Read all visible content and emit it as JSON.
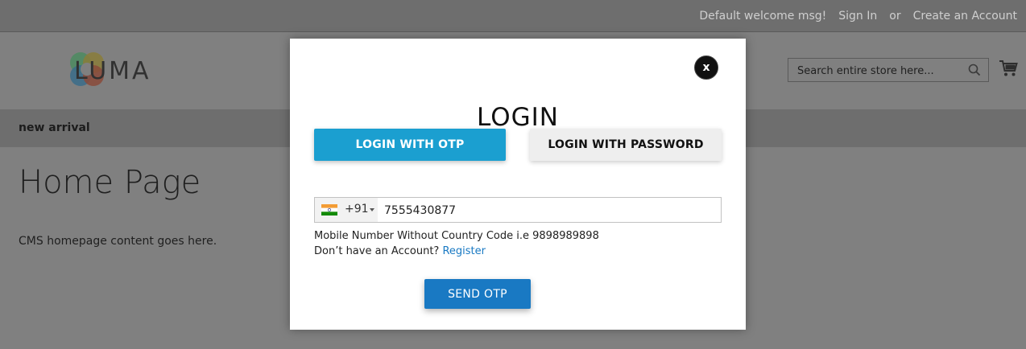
{
  "topbar": {
    "welcome": "Default welcome msg!",
    "sign_in": "Sign In",
    "or": "or",
    "create_account": "Create an Account"
  },
  "header": {
    "logo_text": "LUMA",
    "search_placeholder": "Search entire store here...",
    "search_icon": "search-icon",
    "cart_icon": "cart-icon"
  },
  "nav": {
    "items": [
      {
        "label": "new arrival"
      }
    ]
  },
  "main": {
    "page_title": "Home Page",
    "cms_text": "CMS homepage content goes here."
  },
  "modal": {
    "title": "LOGIN",
    "close_label": "x",
    "tabs": [
      {
        "label": "LOGIN WITH OTP",
        "active": true
      },
      {
        "label": "LOGIN WITH PASSWORD",
        "active": false
      }
    ],
    "phone": {
      "country_flag": "india-flag-icon",
      "dial_code": "+91",
      "value": "7555430877"
    },
    "hint": "Mobile Number Without Country Code i.e 9898989898",
    "no_account_text": "Don’t have an Account?",
    "register_link": "Register",
    "send_button": "SEND OTP"
  },
  "colors": {
    "otp_tab": "#1b9fd0",
    "send_button": "#1979c3",
    "link": "#1979c3",
    "overlay": "#808080"
  }
}
